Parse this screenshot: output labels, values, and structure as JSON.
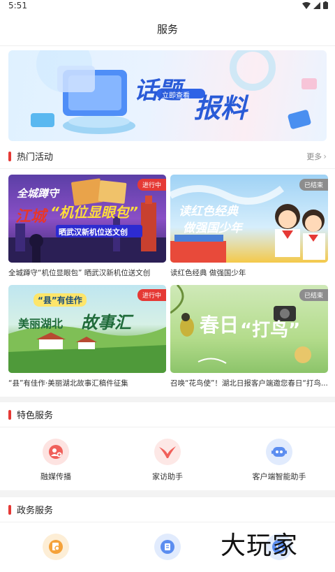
{
  "status_bar": {
    "time": "5:51"
  },
  "nav": {
    "title": "服务"
  },
  "banner": {
    "headline_1": "话题",
    "headline_2": "报料",
    "cta": "立即查看"
  },
  "hot": {
    "title": "热门活动",
    "more": "更多",
    "cards": [
      {
        "title": "全城蹲守“机位显眼包” 晒武汉新机位送文创",
        "badge": "进行中",
        "art_1": "全城蹲守",
        "art_2": "江城",
        "art_3": "“机位显眼包”",
        "art_4": "晒武汉新机位送文创"
      },
      {
        "title": "读红色经典 做强国少年",
        "badge": "已结束",
        "art_1": "读红色经典",
        "art_2": "做强国少年"
      },
      {
        "title": "“县”有佳作·美丽湖北故事汇稿件征集",
        "badge": "进行中",
        "art_1": "“县”有佳作",
        "art_2": "美丽湖北",
        "art_3": "故事汇"
      },
      {
        "title": "召唤“花鸟使”！湖北日报客户端邀您春日“打鸟...",
        "badge": "已结束",
        "art_1": "春日",
        "art_2": "“打鸟”"
      }
    ]
  },
  "special": {
    "title": "特色服务",
    "items": [
      {
        "label": "融媒传播",
        "icon": "media-broadcast-icon",
        "color": "#f0605a"
      },
      {
        "label": "家访助手",
        "icon": "swallow-bird-icon",
        "color": "#f0605a"
      },
      {
        "label": "客户端智能助手",
        "icon": "robot-assistant-icon",
        "color": "#5b8df0"
      }
    ]
  },
  "gov": {
    "title": "政务服务",
    "items": [
      {
        "icon": "document-search-icon",
        "color": "#f5a23a"
      },
      {
        "icon": "badge-document-icon",
        "color": "#5b8df0"
      },
      {
        "icon": "phone-service-icon",
        "color": "#5b8df0"
      }
    ]
  },
  "watermark": {
    "text": "大玩家"
  },
  "colors": {
    "accent": "#e53935",
    "badge_ended": "#8d8d8d"
  }
}
